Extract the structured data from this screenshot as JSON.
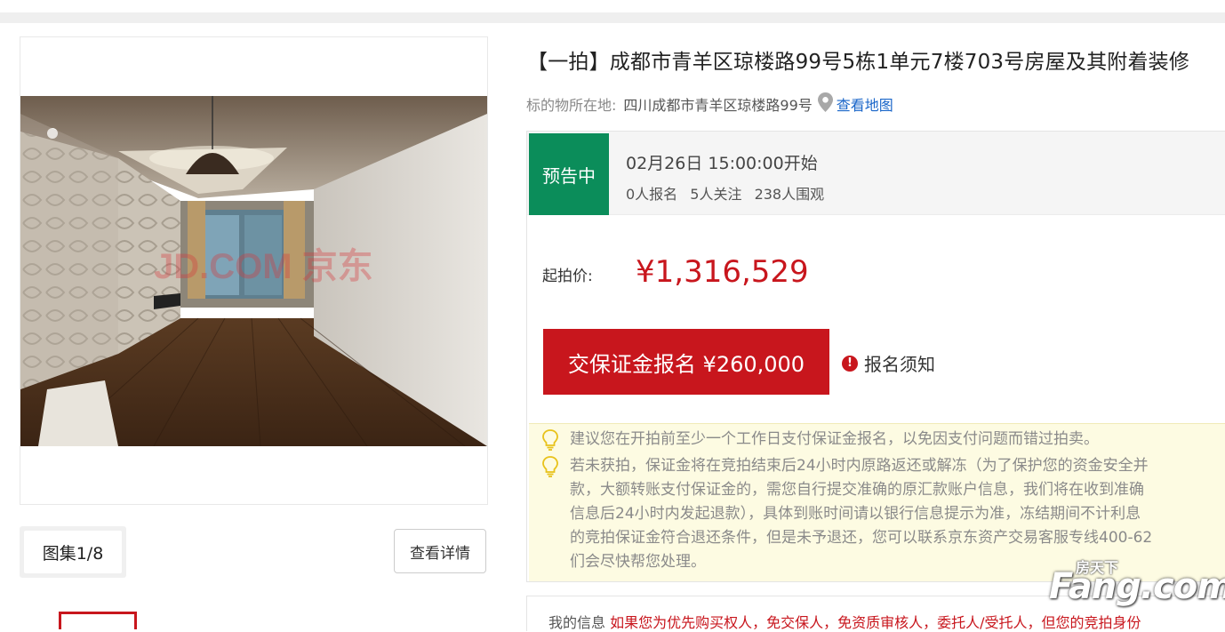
{
  "gallery": {
    "photo_watermark": "JD.COM 京东",
    "album_label": "图集1/8",
    "detail_button": "查看详情"
  },
  "listing": {
    "title": "【一拍】成都市青羊区琼楼路99号5栋1单元7楼703号房屋及其附着装修",
    "location_label": "标的物所在地:",
    "location_value": "四川成都市青羊区琼楼路99号",
    "map_link": "查看地图"
  },
  "auction": {
    "status_badge": "预告中",
    "start_time": "02月26日 15:00:00开始",
    "stats": {
      "signups": "0人报名",
      "followers": "5人关注",
      "viewers": "238人围观"
    },
    "price_label": "起拍价:",
    "price": "¥1,316,529",
    "deposit_button": "交保证金报名 ¥260,000",
    "notice_link": "报名须知"
  },
  "tips": [
    {
      "line1": "建议您在开拍前至少一个工作日支付保证金报名，以免因支付问题而错过拍卖。"
    },
    {
      "line1": "若未获拍，保证金将在竞拍结束后24小时内原路返还或解冻（为了保护您的资金安全并",
      "line2": "款，大额转账支付保证金的，需您自行提交准确的原汇款账户信息，我们将在收到准确",
      "line3": "信息后24小时内发起退款），具体到账时间请以银行信息提示为准，冻结期间不计利息",
      "line4": "的竞拍保证金符合退还条件，但是未予退还，您可以联系京东资产交易客服专线400-62",
      "line5": "们会尽快帮您处理。"
    }
  ],
  "bottom": {
    "label": "我的信息",
    "text": "如果您为优先购买权人，免交保人，免资质审核人，委托人/受托人，但您的竞拍身份"
  },
  "site_watermark": {
    "small": "房天下",
    "big": "Fang.com"
  },
  "colors": {
    "accent_red": "#c8161d",
    "status_green": "#0b8d5a",
    "link_blue": "#1a66c9",
    "tips_bg": "#fdfbe2"
  }
}
